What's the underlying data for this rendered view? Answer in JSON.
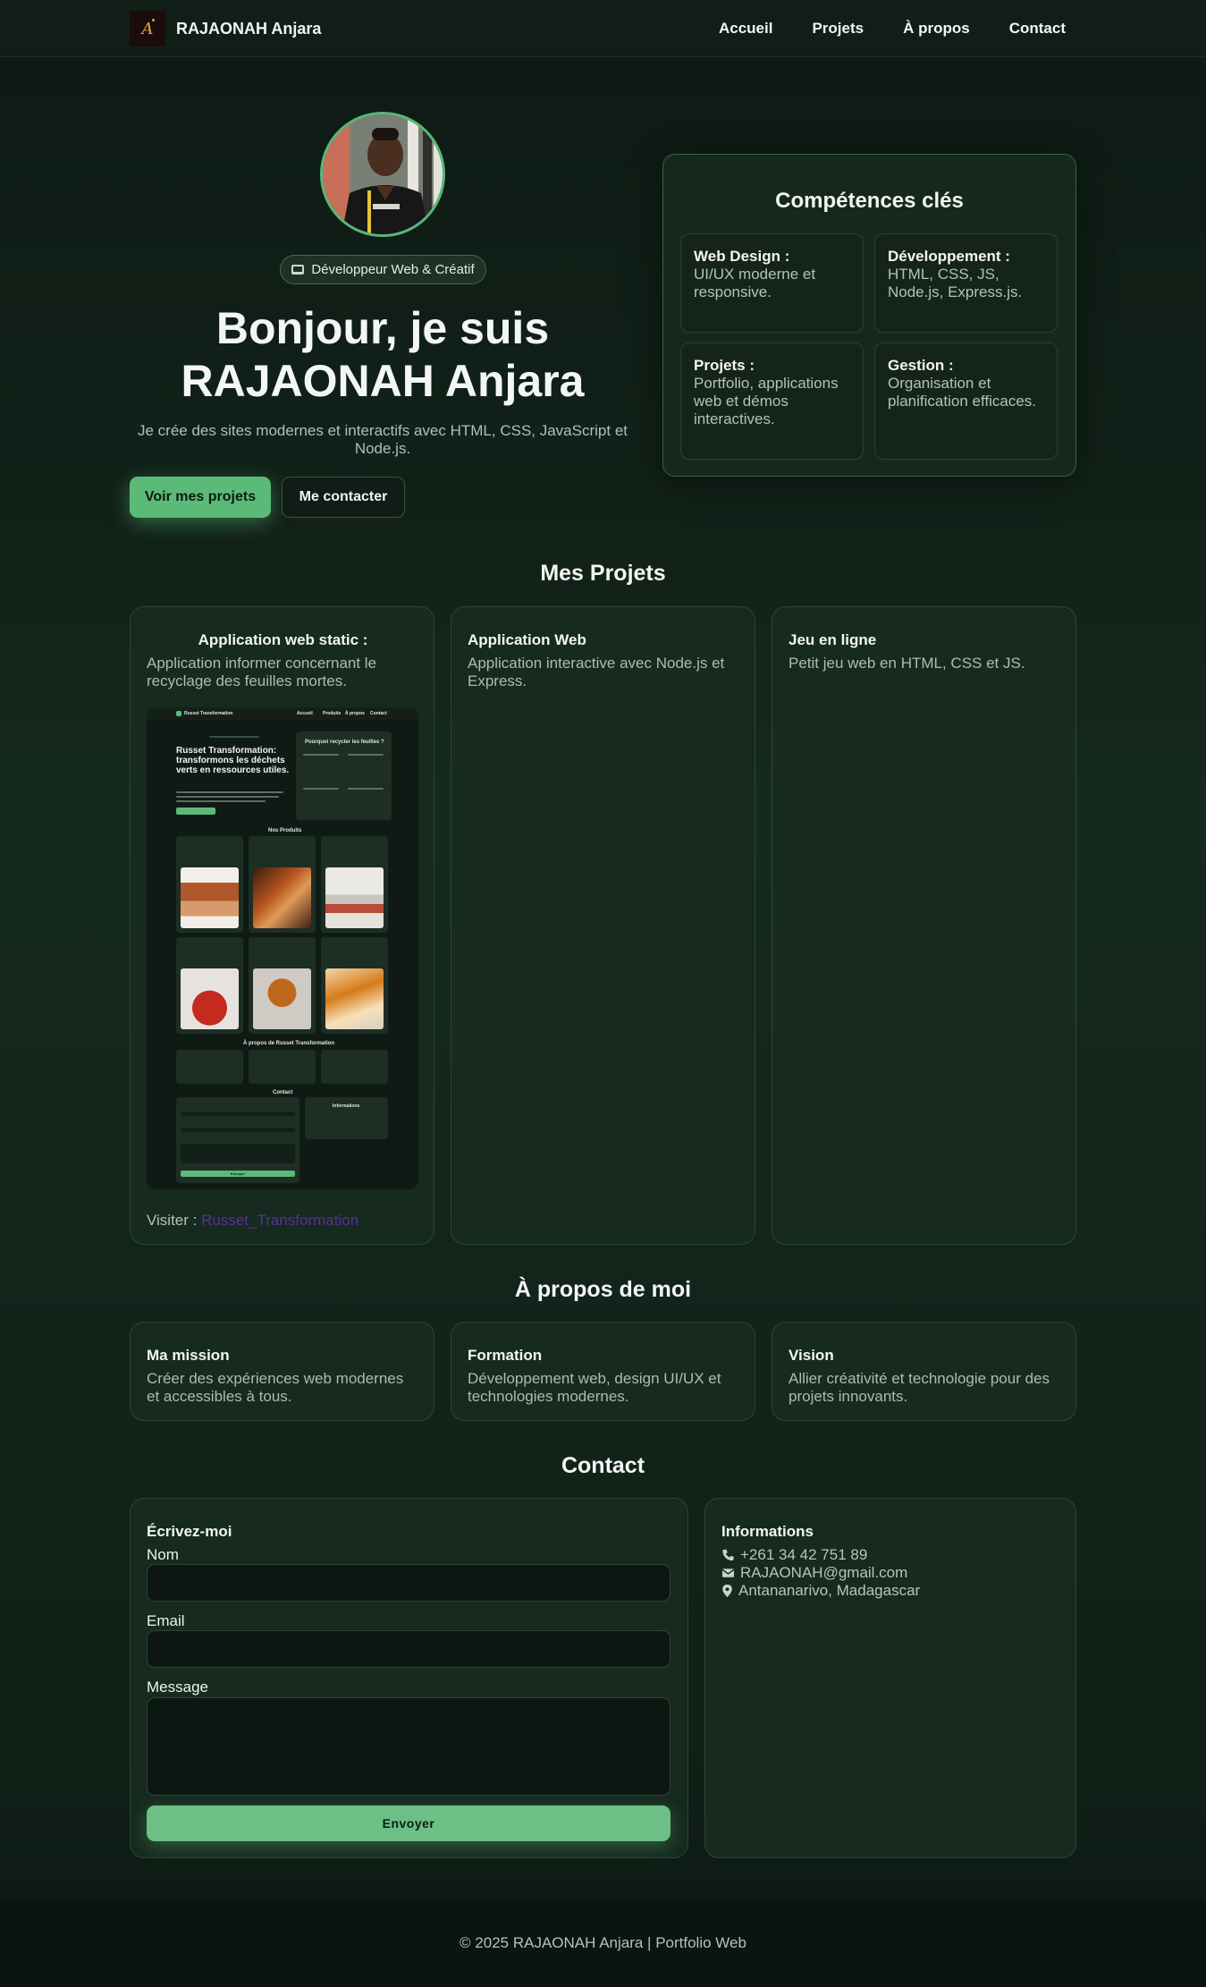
{
  "brand": {
    "name": "RAJAONAH Anjara",
    "logo_letter": "A"
  },
  "nav": {
    "items": [
      "Accueil",
      "Projets",
      "À propos",
      "Contact"
    ]
  },
  "hero": {
    "badge": "Développeur Web & Créatif",
    "title_line1": "Bonjour, je suis",
    "title_line2": "RAJAONAH Anjara",
    "subtitle": "Je crée des sites modernes et interactifs avec HTML, CSS, JavaScript et Node.js.",
    "primary_button": "Voir mes projets",
    "secondary_button": "Me contacter"
  },
  "skills": {
    "title": "Compétences clés",
    "items": [
      {
        "title": "Web Design :",
        "text": "UI/UX moderne et responsive."
      },
      {
        "title": "Développement :",
        "text": "HTML, CSS, JS, Node.js, Express.js."
      },
      {
        "title": "Projets :",
        "text": "Portfolio, applications web et démos interactives."
      },
      {
        "title": "Gestion :",
        "text": "Organisation et planification efficaces."
      }
    ]
  },
  "projects": {
    "title": "Mes Projets",
    "items": [
      {
        "title": "Application web static :",
        "text": "Application informer concernant le recyclage des feuilles mortes.",
        "visit_label": "Visiter :",
        "link_text": "Russet_Transformation"
      },
      {
        "title": "Application Web",
        "text": "Application interactive avec Node.js et Express."
      },
      {
        "title": "Jeu en ligne",
        "text": "Petit jeu web en HTML, CSS et JS."
      }
    ],
    "preview": {
      "header_brand": "Russet Transformation",
      "header_links": [
        "Accueil",
        "Produits",
        "À propos",
        "Contact"
      ],
      "hero_title": "Russet Transformation: transformons les déchets verts en ressources utiles.",
      "panel_title": "Pourquoi recycler les feuilles ?",
      "products_title": "Nos Produits",
      "about_title": "À propos de Russet Transformation",
      "contact_title": "Contact",
      "info_title": "Informations",
      "send_label": "Envoyer"
    }
  },
  "about": {
    "title": "À propos de moi",
    "items": [
      {
        "title": "Ma mission",
        "text": "Créer des expériences web modernes et accessibles à tous."
      },
      {
        "title": "Formation",
        "text": "Développement web, design UI/UX et technologies modernes."
      },
      {
        "title": "Vision",
        "text": "Allier créativité et technologie pour des projets innovants."
      }
    ]
  },
  "contact": {
    "title": "Contact",
    "form": {
      "title": "Écrivez-moi",
      "name_label": "Nom",
      "email_label": "Email",
      "message_label": "Message",
      "name_value": "",
      "email_value": "",
      "message_value": "",
      "submit": "Envoyer"
    },
    "info": {
      "title": "Informations",
      "phone": "+261 34 42 751 89",
      "email": "RAJAONAH@gmail.com",
      "location": "Antananarivo, Madagascar"
    }
  },
  "footer": {
    "text": "© 2025 RAJAONAH Anjara | Portfolio Web"
  },
  "colors": {
    "accent": "#5cba79",
    "background": "#122219",
    "card": "#162a1f",
    "link": "#5a2e9b"
  }
}
